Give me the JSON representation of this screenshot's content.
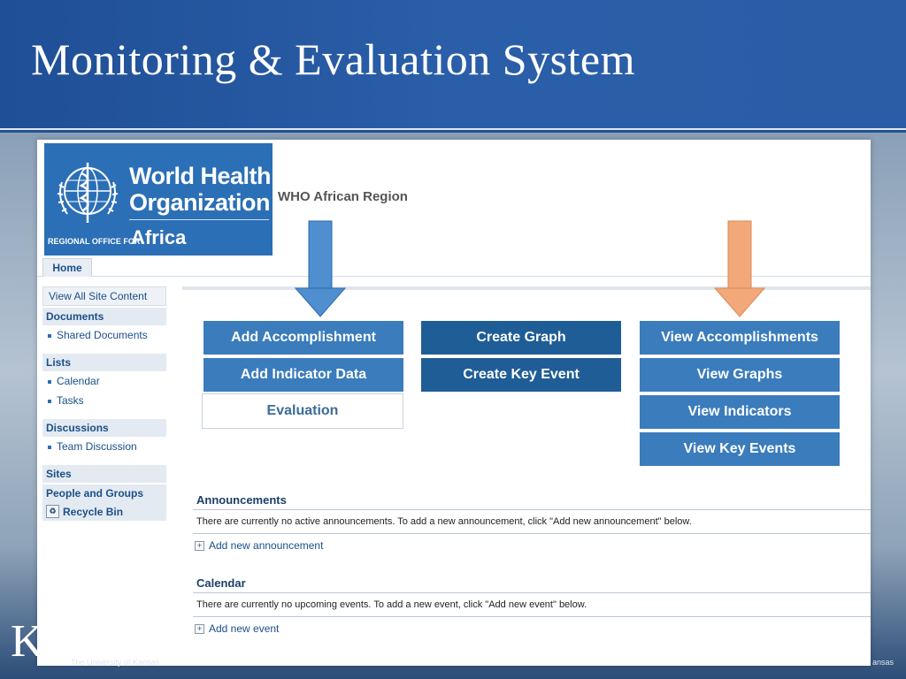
{
  "slide": {
    "title": "Monitoring & Evaluation System",
    "footer_logo": "K",
    "footer_left": "The University of Kansas",
    "footer_right": "ansas"
  },
  "header": {
    "logo_line1": "World Health",
    "logo_line2": "Organization",
    "logo_line3": "REGIONAL OFFICE FOR",
    "logo_line4": "Africa",
    "region_title": "WHO African Region",
    "home_tab": "Home"
  },
  "sidebar": {
    "view_all": "View All Site Content",
    "sections": [
      {
        "label": "Documents",
        "items": [
          "Shared Documents"
        ]
      },
      {
        "label": "Lists",
        "items": [
          "Calendar",
          "Tasks"
        ]
      },
      {
        "label": "Discussions",
        "items": [
          "Team Discussion"
        ]
      },
      {
        "label": "Sites",
        "items": []
      },
      {
        "label": "People and Groups",
        "items": []
      }
    ],
    "recycle_bin": "Recycle Bin"
  },
  "buttons": {
    "add_accomplishment": "Add Accomplishment",
    "add_indicator_data": "Add Indicator Data",
    "evaluation": "Evaluation",
    "create_graph": "Create Graph",
    "create_key_event": "Create Key Event",
    "view_accomplishments": "View Accomplishments",
    "view_graphs": "View Graphs",
    "view_indicators": "View Indicators",
    "view_key_events": "View Key Events"
  },
  "announcements": {
    "title": "Announcements",
    "text": "There are currently no active announcements. To add a new announcement, click \"Add new announcement\" below.",
    "link": "Add new announcement"
  },
  "calendar": {
    "title": "Calendar",
    "text": "There are currently no upcoming events. To add a new event, click \"Add new event\" below.",
    "link": "Add new event"
  },
  "colors": {
    "slide_header": "#2a5ea8",
    "logo_blue": "#2b6fb6",
    "button_light": "#3a7cbc",
    "button_dark": "#1f5d96",
    "arrow_blue": "#4f8fd0",
    "arrow_orange": "#f2a878"
  },
  "icons": [
    "emblem-icon",
    "arrow-down-icon",
    "recycle-bin-icon",
    "plus-icon"
  ]
}
